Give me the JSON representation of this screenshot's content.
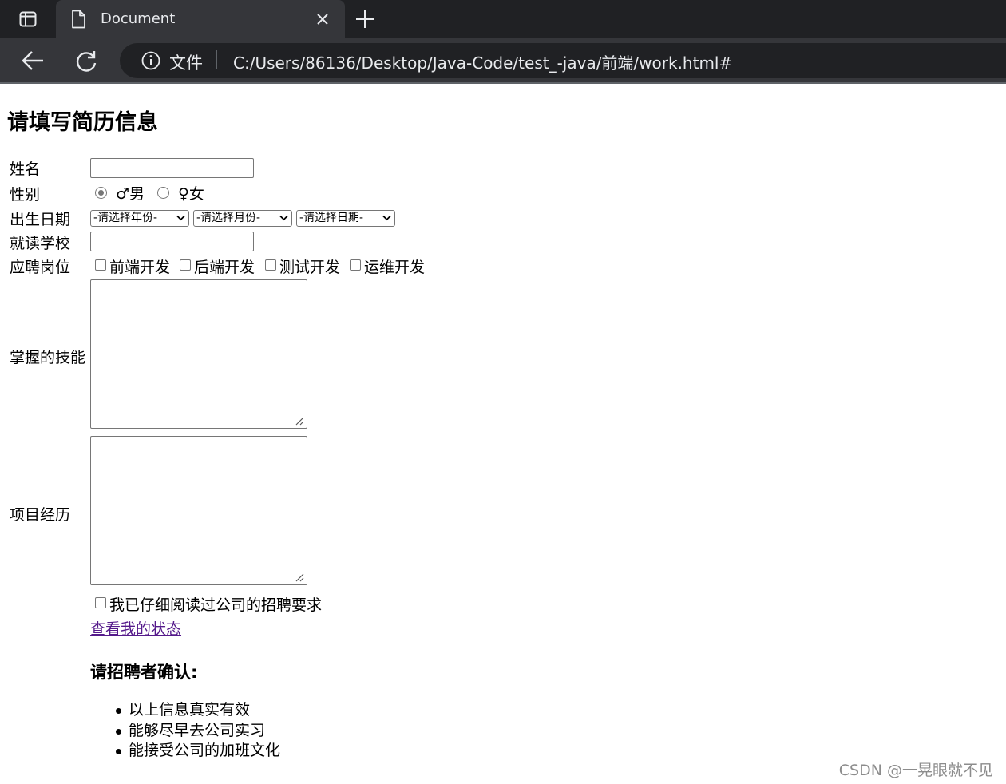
{
  "browser": {
    "tab_title": "Document",
    "address_label": "文件",
    "url": "C:/Users/86136/Desktop/Java-Code/test_-java/前端/work.html#"
  },
  "page": {
    "heading": "请填写简历信息",
    "name_label": "姓名",
    "name_value": "",
    "gender_label": "性别",
    "gender_options": [
      {
        "symbol": "♂",
        "label": "男",
        "checked": true
      },
      {
        "symbol": "♀",
        "label": "女",
        "checked": false
      }
    ],
    "birth_label": "出生日期",
    "birth_selects": [
      "-请选择年份-",
      "-请选择月份-",
      "-请选择日期-"
    ],
    "school_label": "就读学校",
    "school_value": "",
    "position_label": "应聘岗位",
    "positions": [
      "前端开发",
      "后端开发",
      "测试开发",
      "运维开发"
    ],
    "skills_label": "掌握的技能",
    "skills_value": "",
    "project_label": "项目经历",
    "project_value": "",
    "agree_label": "我已仔细阅读过公司的招聘要求",
    "status_link": "查看我的状态",
    "confirm_heading": "请招聘者确认:",
    "confirm_items": [
      "以上信息真实有效",
      "能够尽早去公司实习",
      "能接受公司的加班文化"
    ]
  },
  "watermark": "CSDN @一晃眼就不见"
}
